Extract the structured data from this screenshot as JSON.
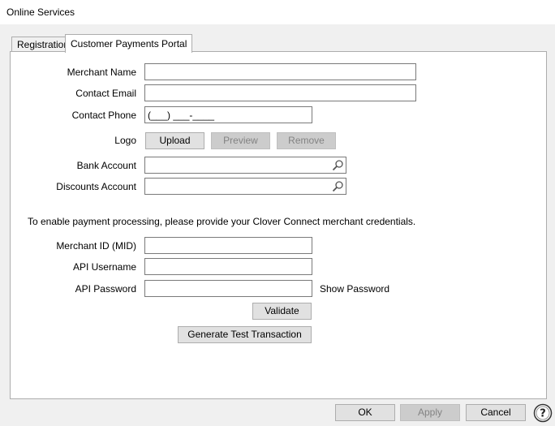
{
  "window": {
    "title": "Online Services"
  },
  "tabs": [
    {
      "label": "Registration"
    },
    {
      "label": "Customer Payments Portal"
    }
  ],
  "form": {
    "merchant_name_label": "Merchant Name",
    "merchant_name_value": "",
    "contact_email_label": "Contact Email",
    "contact_email_value": "",
    "contact_phone_label": "Contact Phone",
    "contact_phone_value": "(___) ___-____",
    "logo_label": "Logo",
    "upload_button": "Upload",
    "preview_button": "Preview",
    "remove_button": "Remove",
    "bank_account_label": "Bank Account",
    "bank_account_value": "",
    "discounts_account_label": "Discounts Account",
    "discounts_account_value": "",
    "credentials_note": "To enable payment processing, please provide your Clover Connect merchant credentials.",
    "merchant_id_label": "Merchant ID (MID)",
    "merchant_id_value": "",
    "api_username_label": "API Username",
    "api_username_value": "",
    "api_password_label": "API Password",
    "api_password_value": "",
    "show_password_label": "Show Password",
    "validate_button": "Validate",
    "generate_test_button": "Generate Test Transaction"
  },
  "footer": {
    "ok_button": "OK",
    "apply_button": "Apply",
    "cancel_button": "Cancel"
  },
  "icons": {
    "lookup": "magnifier-icon",
    "help": "help-icon"
  }
}
